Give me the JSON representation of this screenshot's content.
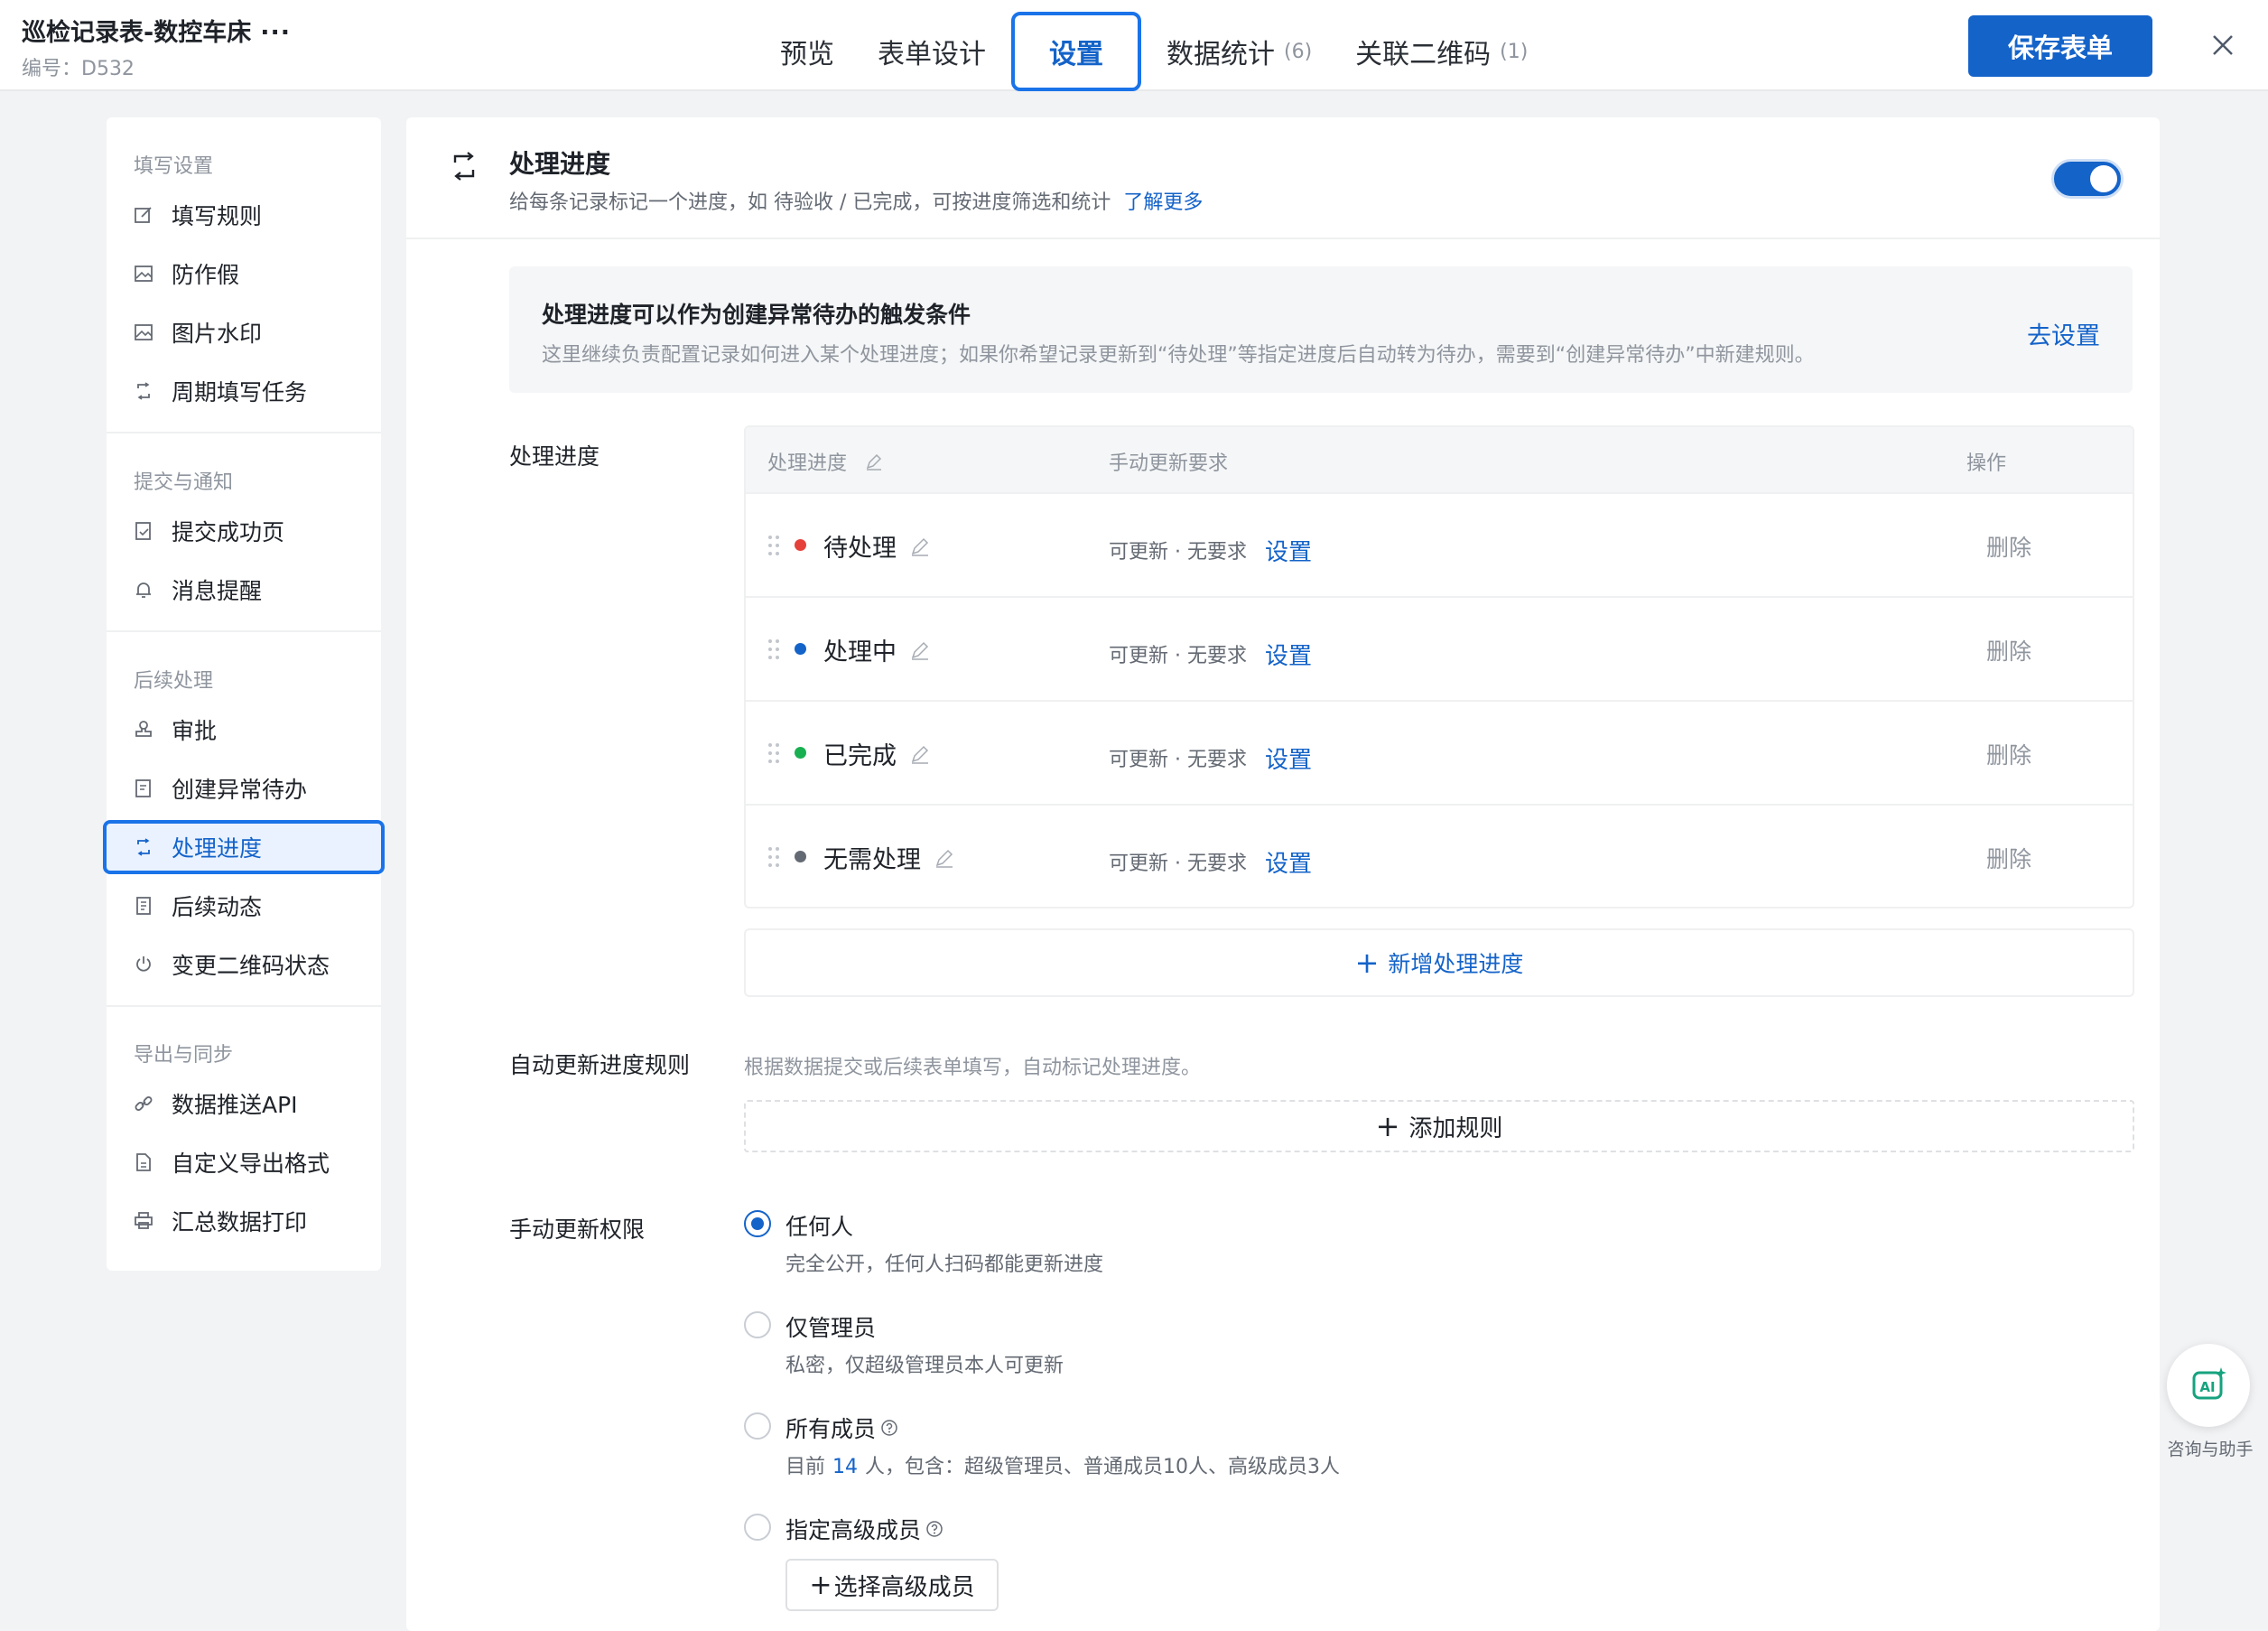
{
  "header": {
    "title": "巡检记录表-数控车床",
    "more": "···",
    "code": "编号：D532",
    "tabs": [
      {
        "label": "预览",
        "count": ""
      },
      {
        "label": "表单设计",
        "count": ""
      },
      {
        "label": "设置",
        "count": ""
      },
      {
        "label": "数据统计",
        "count": "(6)"
      },
      {
        "label": "关联二维码",
        "count": "(1)"
      }
    ],
    "active_tab": "设置",
    "save_label": "保存表单"
  },
  "sidebar": {
    "groups": [
      {
        "title": "填写设置",
        "items": [
          {
            "label": "填写规则",
            "icon": "edit-icon"
          },
          {
            "label": "防作假",
            "icon": "image-icon"
          },
          {
            "label": "图片水印",
            "icon": "image-icon"
          },
          {
            "label": "周期填写任务",
            "icon": "cycle-icon"
          }
        ]
      },
      {
        "title": "提交与通知",
        "items": [
          {
            "label": "提交成功页",
            "icon": "doc-check-icon"
          },
          {
            "label": "消息提醒",
            "icon": "bell-icon"
          }
        ]
      },
      {
        "title": "后续处理",
        "items": [
          {
            "label": "审批",
            "icon": "stamp-icon"
          },
          {
            "label": "创建异常待办",
            "icon": "doc-edit-icon"
          },
          {
            "label": "处理进度",
            "icon": "cycle-icon"
          },
          {
            "label": "后续动态",
            "icon": "doc-list-icon"
          },
          {
            "label": "变更二维码状态",
            "icon": "power-icon"
          }
        ]
      },
      {
        "title": "导出与同步",
        "items": [
          {
            "label": "数据推送API",
            "icon": "link-icon"
          },
          {
            "label": "自定义导出格式",
            "icon": "file-icon"
          },
          {
            "label": "汇总数据打印",
            "icon": "printer-icon"
          }
        ]
      }
    ],
    "active_item": "处理进度"
  },
  "section": {
    "title": "处理进度",
    "desc": "给每条记录标记一个进度，如 待验收 / 已完成，可按进度筛选和统计",
    "learn_more": "了解更多",
    "enabled": true
  },
  "notice": {
    "title": "处理进度可以作为创建异常待办的触发条件",
    "desc": "这里继续负责配置记录如何进入某个处理进度；如果你希望记录更新到“待处理”等指定进度后自动转为待办，需要到“创建异常待办”中新建规则。",
    "link": "去设置"
  },
  "progress": {
    "label": "处理进度",
    "headers": {
      "name": "处理进度",
      "requirement": "手动更新要求",
      "action": "操作"
    },
    "rows": [
      {
        "name": "待处理",
        "color": "#e5403a",
        "req": "可更新 · 无要求",
        "set": "设置",
        "del": "删除"
      },
      {
        "name": "处理中",
        "color": "#1463c9",
        "req": "可更新 · 无要求",
        "set": "设置",
        "del": "删除"
      },
      {
        "name": "已完成",
        "color": "#19b052",
        "req": "可更新 · 无要求",
        "set": "设置",
        "del": "删除"
      },
      {
        "name": "无需处理",
        "color": "#646a73",
        "req": "可更新 · 无要求",
        "set": "设置",
        "del": "删除"
      }
    ],
    "add_label": "新增处理进度"
  },
  "auto_rule": {
    "label": "自动更新进度规则",
    "desc": "根据数据提交或后续表单填写，自动标记处理进度。",
    "add_label": "添加规则"
  },
  "permission": {
    "label": "手动更新权限",
    "options": [
      {
        "label": "任何人",
        "desc": "完全公开，任何人扫码都能更新进度",
        "selected": true
      },
      {
        "label": "仅管理员",
        "desc": "私密，仅超级管理员本人可更新",
        "selected": false
      },
      {
        "label": "所有成员",
        "desc_pre": "目前",
        "desc_num": "14",
        "desc_post": "人，包含：超级管理员、普通成员10人、高级成员3人",
        "selected": false
      },
      {
        "label": "指定高级成员",
        "selected": false
      }
    ],
    "select_label": "选择高级成员"
  },
  "assistant": {
    "label": "咨询与助手",
    "icon": "ai-icon"
  },
  "colors": {
    "accent": "#1463c9",
    "background": "#f2f3f5"
  }
}
